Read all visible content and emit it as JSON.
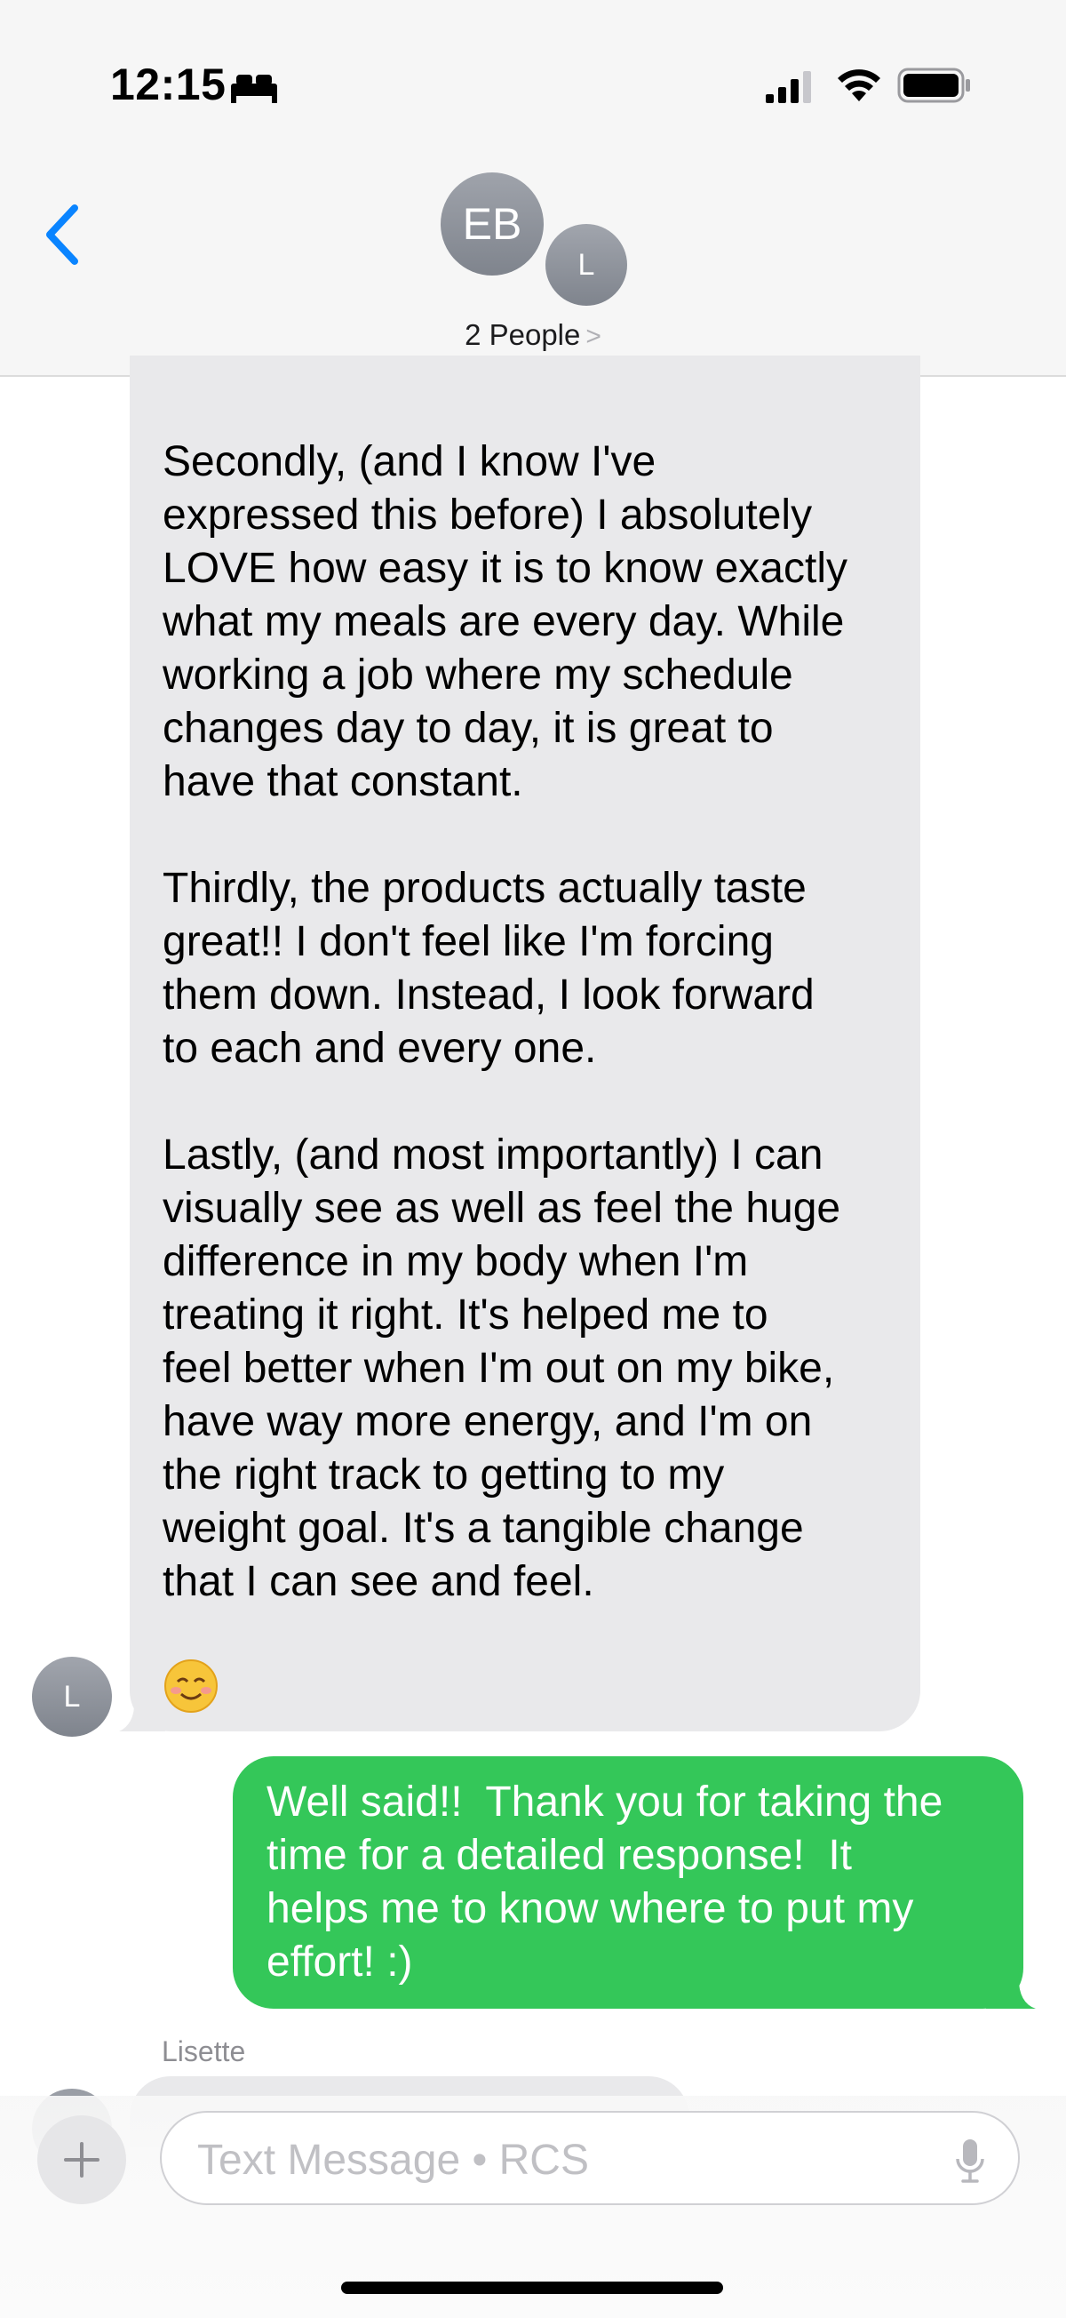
{
  "status_bar": {
    "time": "12:15"
  },
  "header": {
    "back_icon": "chevron-left-icon",
    "group_avatar_initials": "EB",
    "member_avatar_initial": "L",
    "people_label": "2 People",
    "people_chevron": ">"
  },
  "messages": [
    {
      "direction": "incoming",
      "sender_initial": "L",
      "text": "Secondly, (and I know I've\nexpressed this before) I absolutely\nLOVE how easy it is to know exactly\nwhat my meals are every day. While\nworking a job where my schedule\nchanges day to day, it is great to\nhave that constant.\n\nThirdly, the products actually taste\ngreat!! I don't feel like I'm forcing\nthem down. Instead, I look forward\nto each and every one.\n\nLastly, (and most importantly) I can\nvisually see as well as feel the huge\ndifference in my body when I'm\ntreating it right. It's helped me to\nfeel better when I'm out on my bike,\nhave way more energy, and I'm on\nthe right track to getting to my\nweight goal. It's a tangible change\nthat I can see and feel.",
      "emoji": "☺️"
    },
    {
      "direction": "outgoing",
      "text": "Well said!!  Thank you for taking the\ntime for a detailed response!  It\nhelps me to know where to put my\neffort! :)"
    },
    {
      "direction": "incoming",
      "sender_name": "Lisette"
    }
  ],
  "composer": {
    "placeholder": "Text Message • RCS"
  },
  "colors": {
    "incoming_bubble": "#e9e9eb",
    "outgoing_bubble": "#34c759",
    "accent": "#0a84ff"
  }
}
